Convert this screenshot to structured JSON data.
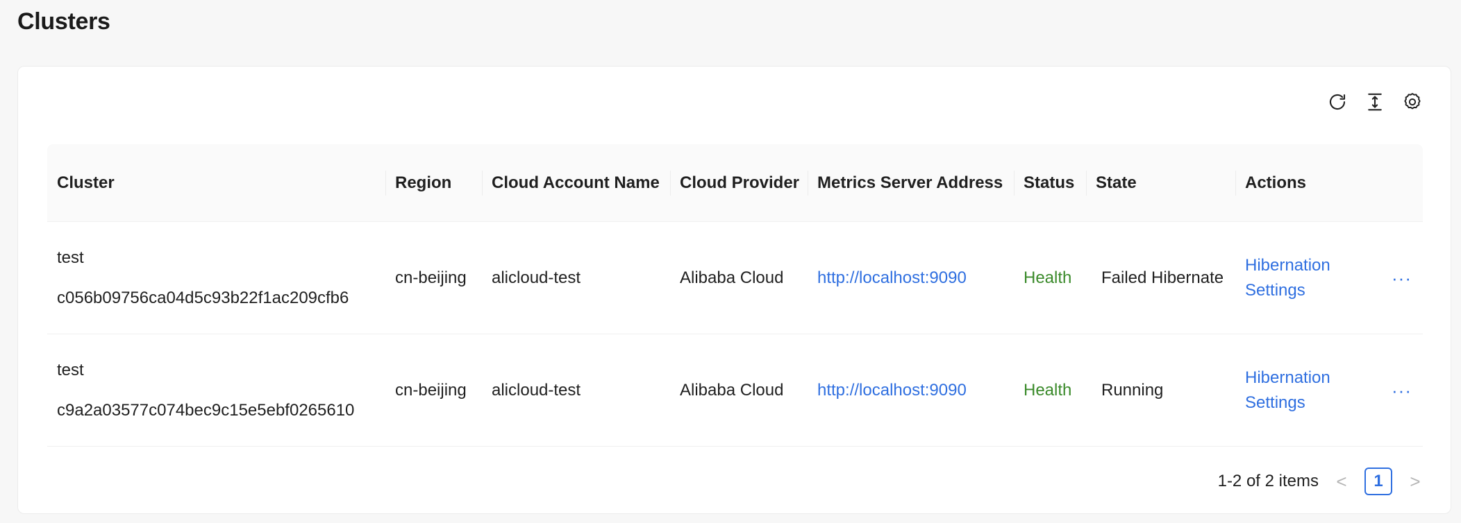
{
  "page": {
    "title": "Clusters"
  },
  "toolbar": {
    "icons": [
      "refresh-icon",
      "column-height-icon",
      "settings-icon"
    ]
  },
  "table": {
    "columns": [
      "Cluster",
      "Region",
      "Cloud Account Name",
      "Cloud Provider",
      "Metrics Server Address",
      "Status",
      "State",
      "Actions"
    ],
    "rows": [
      {
        "cluster_name": "test",
        "cluster_id": "c056b09756ca04d5c93b22f1ac209cfb6",
        "region": "cn-beijing",
        "cloud_account": "alicloud-test",
        "cloud_provider": "Alibaba Cloud",
        "metrics_address": "http://localhost:9090",
        "status": "Health",
        "state": "Failed Hibernate",
        "action_label": "Hibernation Settings",
        "more_label": "···"
      },
      {
        "cluster_name": "test",
        "cluster_id": "c9a2a03577c074bec9c15e5ebf0265610",
        "region": "cn-beijing",
        "cloud_account": "alicloud-test",
        "cloud_provider": "Alibaba Cloud",
        "metrics_address": "http://localhost:9090",
        "status": "Health",
        "state": "Running",
        "action_label": "Hibernation Settings",
        "more_label": "···"
      }
    ]
  },
  "pagination": {
    "summary": "1-2 of 2 items",
    "current_page": "1",
    "prev": "<",
    "next": ">"
  },
  "colors": {
    "link": "#2f6fe0",
    "health": "#3a8a2a",
    "header_bg": "#fafafa"
  }
}
